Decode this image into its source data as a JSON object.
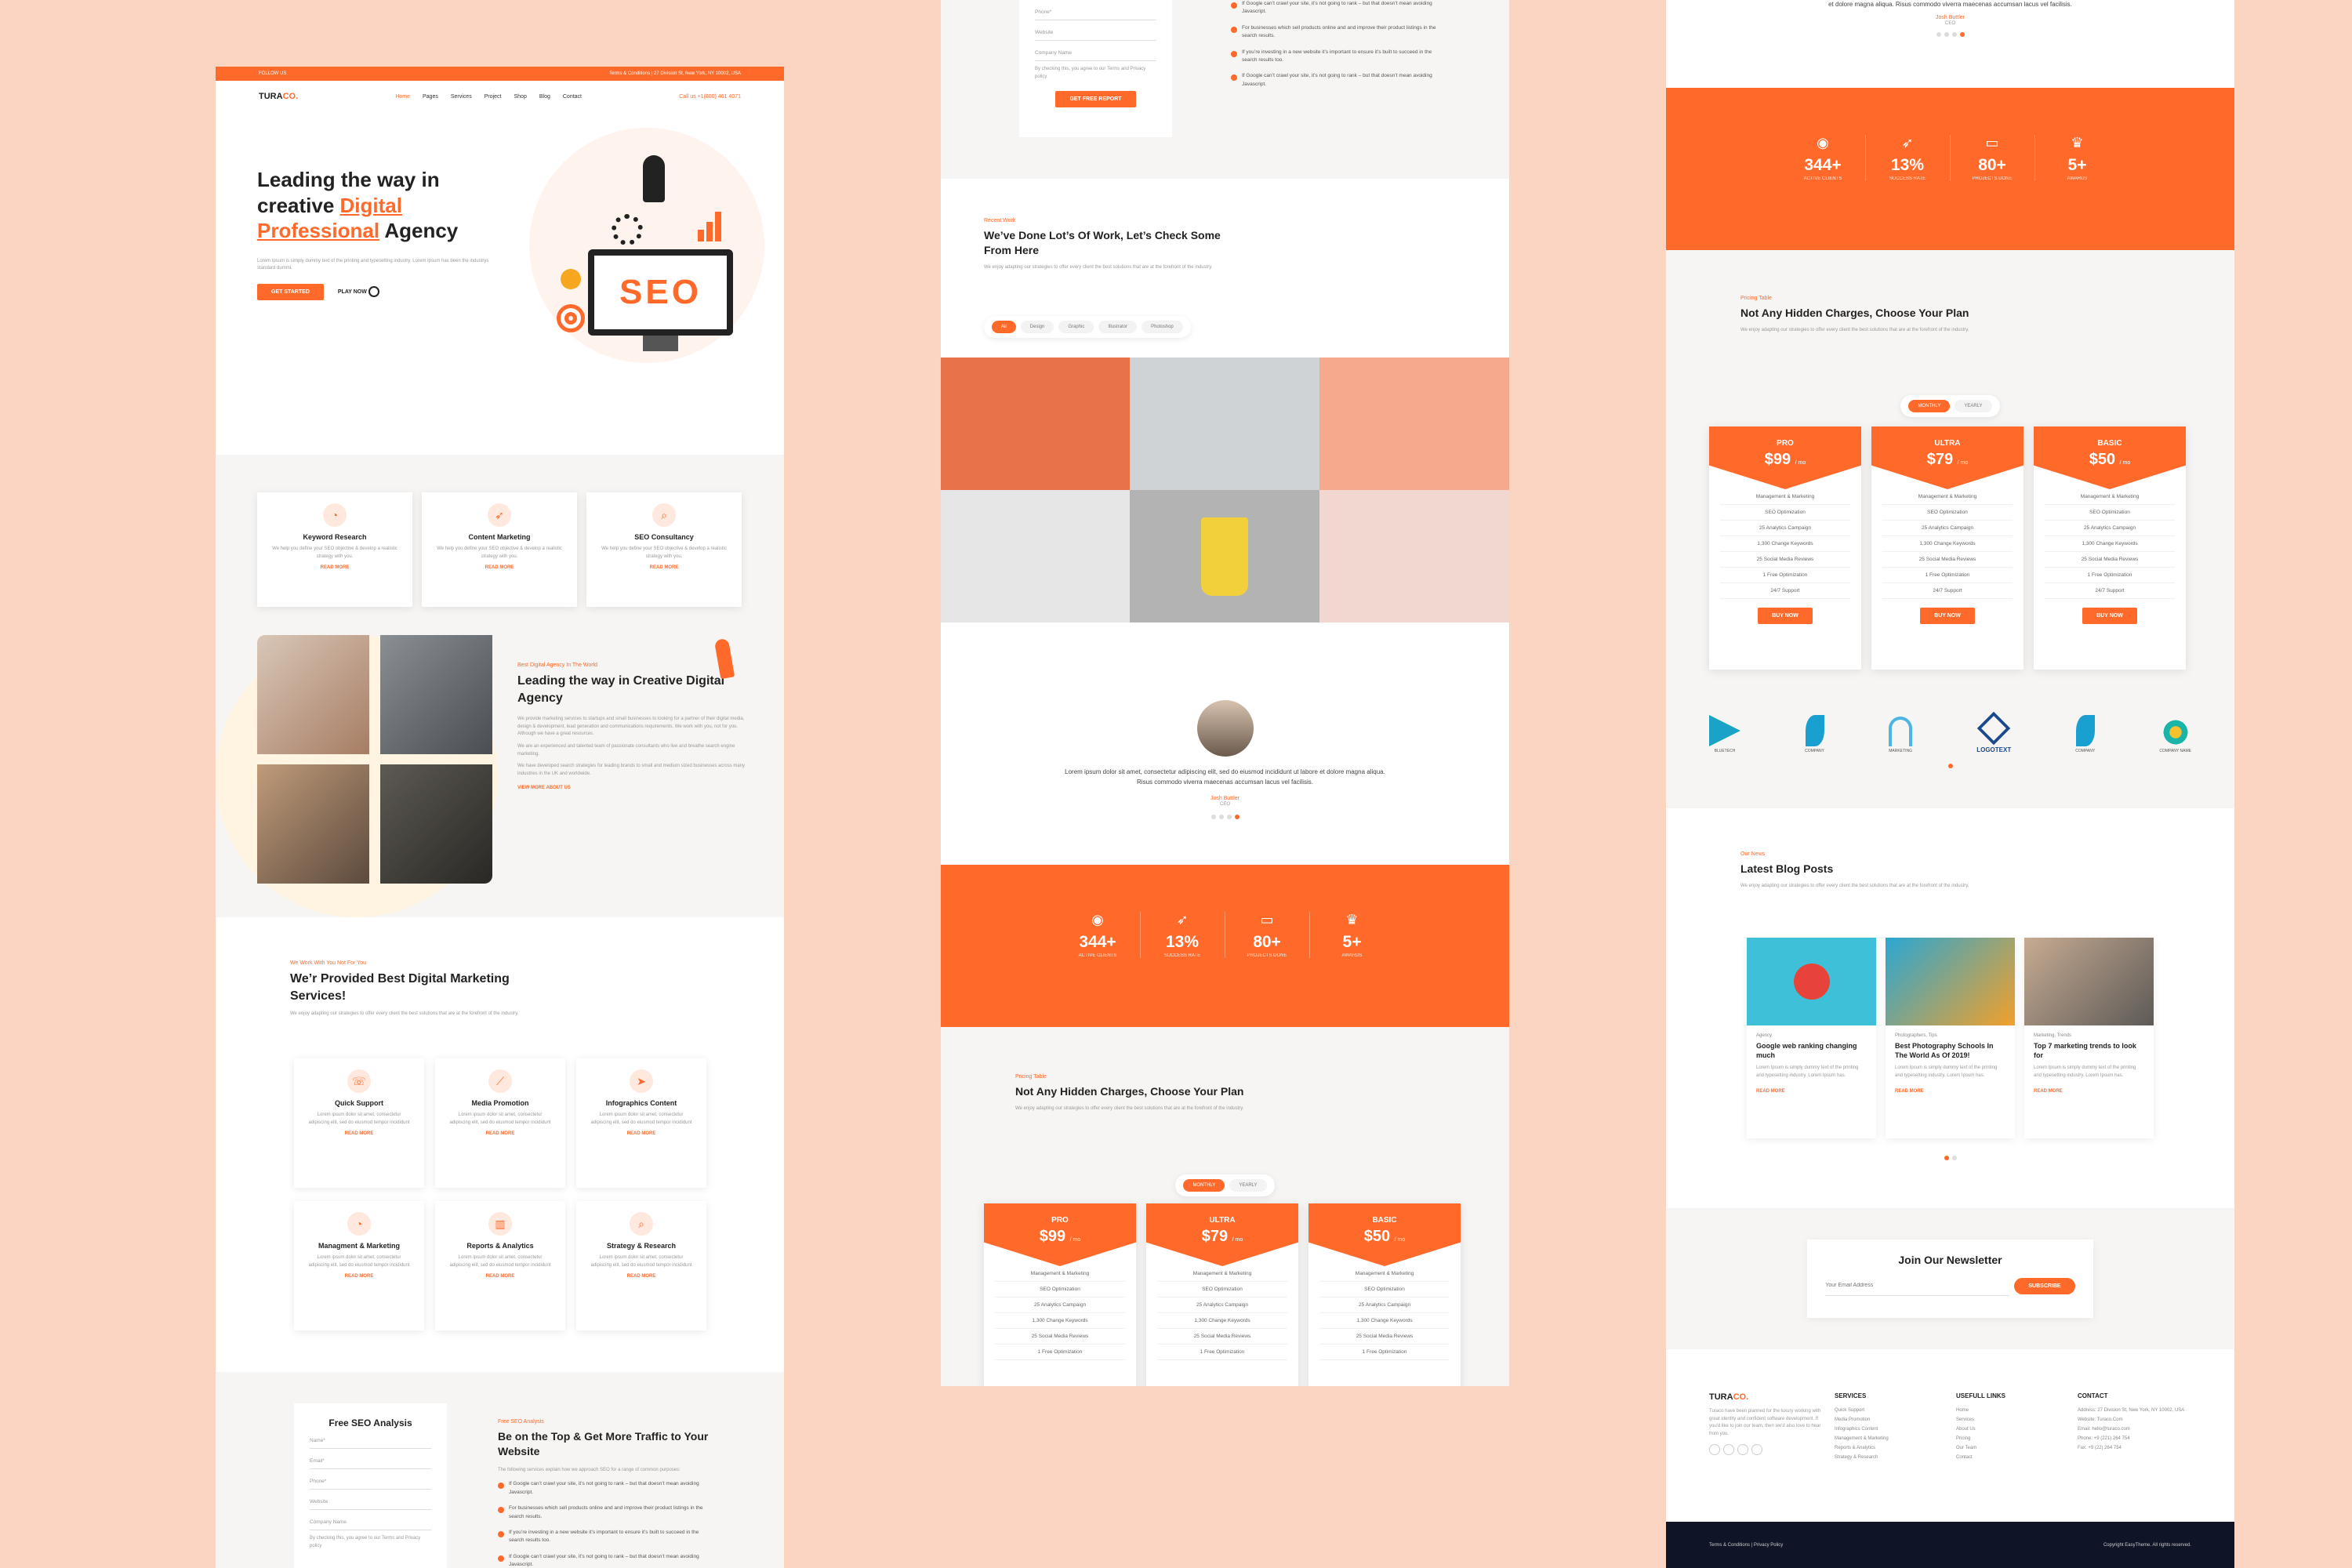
{
  "col1": {
    "topbar": {
      "follow": "FOLLOW US",
      "links": "Terms & Conditions  |  27 Division St, New York, NY 10002, USA"
    },
    "logo": {
      "prefix": "TURA",
      "suffix": "CO."
    },
    "menu": [
      "Home",
      "Pages",
      "Services",
      "Project",
      "Shop",
      "Blog",
      "Contact"
    ],
    "call": "Call us  +1(800) 461 4071",
    "hero": {
      "title_1": "Leading the way in",
      "title_2": "creative ",
      "title_hl1": "Digital",
      "title_hl2": "Professional",
      "title_3": " Agency",
      "text": "Lorem Ipsum is simply dummy text of the printing and typesetting industry. Lorem Ipsum has been the industrys standard dummi.",
      "cta": "GET STARTED",
      "play": "PLAY NOW",
      "seo": "SEO"
    },
    "features": [
      {
        "title": "Keyword Research",
        "text": "We help you define your SEO objective & develop a realistic strategy with you.",
        "more": "READ MORE"
      },
      {
        "title": "Content Marketing",
        "text": "We help you define your SEO objective & develop a realistic strategy with you.",
        "more": "READ MORE"
      },
      {
        "title": "SEO Consultancy",
        "text": "We help you define your SEO objective & develop a realistic strategy with you.",
        "more": "READ MORE"
      }
    ],
    "about": {
      "sub": "Best Digital Agency In The World",
      "title": "Leading the way in Creative Digital Agency",
      "p1": "We provide marketing services to startups and small businesses to looking for a partner of their digital media, design & development, lead generation and communications requirements. We work with you, not for you. Although we have a great resources.",
      "p2": "We are an experienced and talented team of passionate consultants who live and breathe search engine marketing.",
      "p3": "We have developed search strategies for leading brands to small and medium sized businesses across many industries in the UK and worldwide.",
      "more": "VIEW MORE ABOUT US"
    },
    "services": {
      "sub": "We Work With You Not For You",
      "title": "We’r Provided Best Digital Marketing Services!",
      "text": "We enjoy adapting our strategies to offer every client the best solutions that are at the forefront of the industry.",
      "items": [
        {
          "title": "Quick Support",
          "text": "Lorem ipsum dolor sit amet, consectetur adipiscing elit, sed do eiusmod tempor incididunt",
          "more": "READ MORE"
        },
        {
          "title": "Media Promotion",
          "text": "Lorem ipsum dolor sit amet, consectetur adipiscing elit, sed do eiusmod tempor incididunt",
          "more": "READ MORE"
        },
        {
          "title": "Infographics Content",
          "text": "Lorem ipsum dolor sit amet, consectetur adipiscing elit, sed do eiusmod tempor incididunt",
          "more": "READ MORE"
        },
        {
          "title": "Managment & Marketing",
          "text": "Lorem ipsum dolor sit amet, consectetur adipiscing elit, sed do eiusmod tempor incididunt",
          "more": "READ MORE"
        },
        {
          "title": "Reports & Analytics",
          "text": "Lorem ipsum dolor sit amet, consectetur adipiscing elit, sed do eiusmod tempor incididunt",
          "more": "READ MORE"
        },
        {
          "title": "Strategy & Research",
          "text": "Lorem ipsum dolor sit amet, consectetur adipiscing elit, sed do eiusmod tempor incididunt",
          "more": "READ MORE"
        }
      ]
    },
    "analysis": {
      "form_title": "Free SEO Analysis",
      "fields": [
        "Name*",
        "Email*",
        "Phone*",
        "Website",
        "Company Name"
      ],
      "agree": "By checking this, you agree to our Terms and Privacy policy",
      "submit": "GET FREE REPORT",
      "sub": "Free SEO Analysis",
      "title": "Be on the Top & Get More Traffic to Your Website",
      "text": "The following services explain how we approach SEO for a range of common purposes:",
      "points": [
        "If Google can’t crawl your site, it’s not going to rank – but that doesn’t mean avoiding Javascript.",
        "For businesses which sell products online and and improve their product listings in the search results.",
        "If you’re investing in a new website it’s important to ensure it’s built to succeed in the search results too.",
        "If Google can’t crawl your site, it’s not going to rank – but that doesn’t mean avoiding Javascript."
      ]
    }
  },
  "col2": {
    "form_top": {
      "fields": [
        "Phone*",
        "Website",
        "Company Name"
      ],
      "agree": "By checking this, you agree to our Terms and Privacy policy",
      "submit": "GET FREE REPORT",
      "points": [
        "If Google can’t crawl your site, it’s not going to rank – but that doesn’t mean avoiding Javascript.",
        "For businesses which sell products online and and improve their product listings in the search results.",
        "If you’re investing in a new website it’s important to ensure it’s built to succeed in the search results too.",
        "If Google can’t crawl your site, it’s not going to rank – but that doesn’t mean avoiding Javascript."
      ]
    },
    "portfolio": {
      "sub": "Recent Work",
      "title": "We’ve Done Lot’s Of Work, Let’s Check Some From Here",
      "text": "We enjoy adapting our strategies to offer every client the best solutions that are at the forefront of the industry.",
      "tabs": [
        "All",
        "Design",
        "Graphic",
        "Illustrator",
        "Photoshop"
      ]
    },
    "testimonial": {
      "quote": "Lorem ipsum dolor sit amet, consectetur adipiscing elit, sed do eiusmod incididunt ut labore et dolore magna aliqua. Risus commodo viverra maecenas accumsan lacus vel facilisis.",
      "name": "Josh Buttler",
      "role": "CEO"
    },
    "stats": [
      {
        "n": "344+",
        "l": "ACTIVE CLIENTS"
      },
      {
        "n": "13%",
        "l": "SUCCESS RATE"
      },
      {
        "n": "80+",
        "l": "PROJECTS DONE"
      },
      {
        "n": "5+",
        "l": "AWARDS"
      }
    ],
    "pricing": {
      "sub": "Pricing Table",
      "title": "Not Any Hidden Charges, Choose Your Plan",
      "text": "We enjoy adapting our strategies to offer every client the best solutions that are at the forefront of the industry.",
      "toggle": [
        "MONTHLY",
        "YEARLY"
      ],
      "plans": [
        {
          "name": "PRO",
          "price": "$99",
          "per": "/ mo"
        },
        {
          "name": "ULTRA",
          "price": "$79",
          "per": "/ mo"
        },
        {
          "name": "BASIC",
          "price": "$50",
          "per": "/ mo"
        }
      ],
      "features": [
        "Management & Marketing",
        "SEO Optimization",
        "25 Analytics Campaign",
        "1,300 Change Keywords",
        "25 Social Media Reviews",
        "1 Free Optimization"
      ]
    }
  },
  "col3": {
    "testimonial": {
      "quote": "et dolore magna aliqua. Risus commodo viverra maecenas accumsan lacus vel facilisis.",
      "name": "Josh Buttler",
      "role": "CEO"
    },
    "stats": [
      {
        "n": "344+",
        "l": "ACTIVE CLIENTS"
      },
      {
        "n": "13%",
        "l": "SUCCESS RATE"
      },
      {
        "n": "80+",
        "l": "PROJECTS DONE"
      },
      {
        "n": "5+",
        "l": "AWARDS"
      }
    ],
    "pricing": {
      "sub": "Pricing Table",
      "title": "Not Any Hidden Charges, Choose Your Plan",
      "text": "We enjoy adapting our strategies to offer every client the best solutions that are at the forefront of the industry.",
      "toggle": [
        "MONTHLY",
        "YEARLY"
      ],
      "plans": [
        {
          "name": "PRO",
          "price": "$99",
          "per": "/ mo"
        },
        {
          "name": "ULTRA",
          "price": "$79",
          "per": "/ mo"
        },
        {
          "name": "BASIC",
          "price": "$50",
          "per": "/ mo"
        }
      ],
      "features": [
        "Management & Marketing",
        "SEO Optimization",
        "25 Analytics Campaign",
        "1,300 Change Keywords",
        "25 Social Media Reviews",
        "1 Free Optimization",
        "24/7 Support"
      ],
      "buy": "BUY NOW"
    },
    "brands": [
      "BLUETECH",
      "COMPANY",
      "MARKETING",
      "LOGOTEXT",
      "COMPANY",
      "COMPANY NAME"
    ],
    "blog": {
      "sub": "Our News",
      "title": "Latest Blog Posts",
      "text": "We enjoy adapting our strategies to offer every client the best solutions that are at the forefront of the industry.",
      "posts": [
        {
          "cat": "Agency",
          "title": "Google web ranking changing much",
          "text": "Lorem Ipsum is simply dummy text of the printing and typesetting industry. Lorem Ipsum has.",
          "more": "READ MORE"
        },
        {
          "cat": "Photographers, Tips",
          "title": "Best Photography Schools In The World As Of 2019!",
          "text": "Lorem Ipsum is simply dummy text of the printing and typesetting industry. Lorem Ipsum has.",
          "more": "READ MORE"
        },
        {
          "cat": "Marketing, Trends",
          "title": "Top 7 marketing trends to look for",
          "text": "Lorem Ipsum is simply dummy text of the printing and typesetting industry. Lorem Ipsum has.",
          "more": "READ MORE"
        }
      ]
    },
    "newsletter": {
      "title": "Join Our Newsletter",
      "placeholder": "Your Email Address",
      "button": "SUBSCRIBE"
    },
    "footer": {
      "about": "Turaco have been planned for the luxury working with great identity and confident software development. If you'd like to join our team, then we'd also love to hear from you.",
      "services_title": "SERVICES",
      "services": [
        "Quick Support",
        "Media Promotion",
        "Infographics Content",
        "Management & Marketing",
        "Reports & Analytics",
        "Strategy & Research"
      ],
      "links_title": "USEFULL LINKS",
      "links": [
        "Home",
        "Services",
        "About Us",
        "Pricing",
        "Our Team",
        "Contact"
      ],
      "contact_title": "CONTACT",
      "contact": [
        "Address: 27 Division St, New York, NY 10002, USA",
        "Website: Turaco.Com",
        "Email: hello@turaco.com",
        "Phone: +9 (221) 264 754",
        "Fax: +9 (22) 264 754"
      ],
      "bottom_left": "Terms & Conditions  |  Privacy Policy",
      "bottom_right": "Copyright EasyTheme. All rights reserved."
    }
  }
}
